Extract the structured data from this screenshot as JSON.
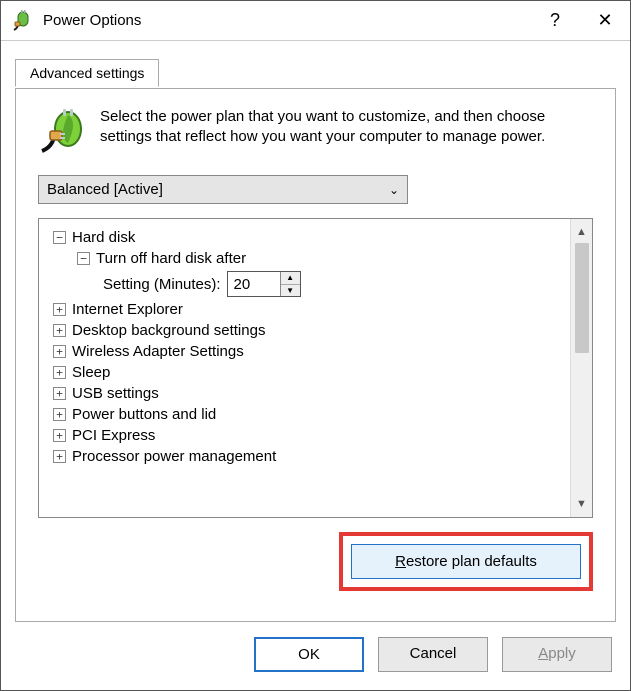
{
  "window": {
    "title": "Power Options",
    "help_glyph": "?",
    "close_glyph": "✕"
  },
  "tab": {
    "label": "Advanced settings"
  },
  "description": "Select the power plan that you want to customize, and then choose settings that reflect how you want your computer to manage power.",
  "plan_selector": {
    "selected": "Balanced [Active]",
    "chevron": "⌄"
  },
  "tree": {
    "hard_disk": {
      "label": "Hard disk",
      "turn_off": {
        "label": "Turn off hard disk after",
        "setting_label": "Setting (Minutes):",
        "value": "20"
      }
    },
    "items": [
      "Internet Explorer",
      "Desktop background settings",
      "Wireless Adapter Settings",
      "Sleep",
      "USB settings",
      "Power buttons and lid",
      "PCI Express",
      "Processor power management"
    ],
    "minus": "−",
    "plus": "+"
  },
  "restore": {
    "prefix": "R",
    "rest": "estore plan defaults"
  },
  "buttons": {
    "ok": "OK",
    "cancel": "Cancel",
    "apply_prefix": "A",
    "apply_rest": "pply"
  },
  "scroll": {
    "up": "▲",
    "down": "▼"
  },
  "spinner": {
    "up": "▲",
    "down": "▼"
  }
}
